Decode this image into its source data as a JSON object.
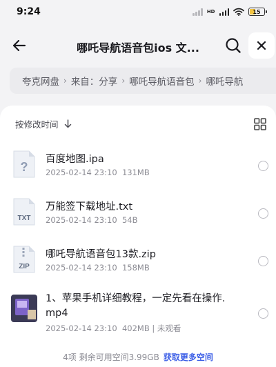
{
  "status_bar": {
    "time": "9:24",
    "network": "HD",
    "battery_level": "15",
    "battery_color": "#f4c542"
  },
  "nav": {
    "back_icon": "arrow-left-icon",
    "title": "哪吒导航语音包ios 文...",
    "search_icon": "search-icon",
    "close_icon": "close-icon"
  },
  "breadcrumb": {
    "items": [
      "夸克网盘",
      "来自：分享",
      "哪吒导航语音包",
      "哪吒导航"
    ]
  },
  "sort": {
    "label": "按修改时间",
    "direction_icon": "arrow-down-icon",
    "view_icon": "grid-view-icon"
  },
  "files": [
    {
      "name": "百度地图.ipa",
      "date": "2025-02-14 23:10",
      "size": "131MB",
      "extra": "",
      "icon": "unknown-file-icon",
      "icon_label": "?"
    },
    {
      "name": "万能签下载地址.txt",
      "date": "2025-02-14 23:10",
      "size": "54B",
      "extra": "",
      "icon": "txt-file-icon",
      "icon_label": "TXT"
    },
    {
      "name": "哪吒导航语音包13款.zip",
      "date": "2025-02-14 23:10",
      "size": "158MB",
      "extra": "",
      "icon": "zip-file-icon",
      "icon_label": "ZIP"
    },
    {
      "name_line1": "1、苹果手机详细教程，一定先看在操作.",
      "name_line2": "mp4",
      "date": "2025-02-14 23:10",
      "size": "402MB",
      "extra": "未观看",
      "icon": "video-thumbnail-icon"
    }
  ],
  "footer": {
    "summary": "4项  剩余可用空间3.99GB",
    "link": "获取更多空间",
    "link_color": "#3a5de6"
  }
}
